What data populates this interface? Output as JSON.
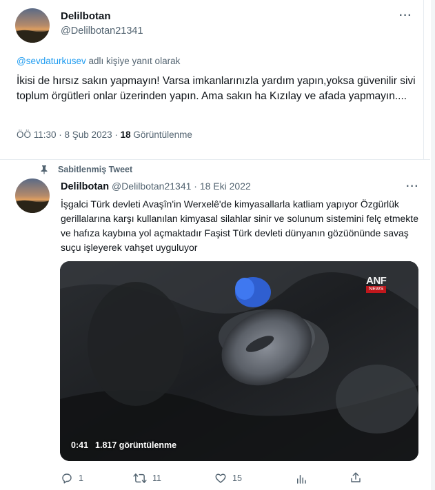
{
  "reply_tweet": {
    "display_name": "Delilbotan",
    "handle": "@Delilbotan21341",
    "reply_to_handle": "@sevdaturkusev",
    "reply_to_suffix": "adlı kişiye yanıt olarak",
    "text": "İkisi de hırsız sakın yapmayın! Varsa imkanlarınızla yardım yapın,yoksa güvenilir sivi toplum örgütleri onlar üzerinden yapın. Ama sakın ha Kızılay ve afada yapmayın....",
    "timestamp": "ÖÖ 11:30 · 8 Şub 2023 · ",
    "views_count": "18",
    "views_label": " Görüntülenme",
    "more_icon": "more-horizontal-icon"
  },
  "pinned_tweet": {
    "pinned_label": "Sabitlenmiş Tweet",
    "display_name": "Delilbotan",
    "handle": "@Delilbotan21341",
    "date": "· 18 Eki 2022",
    "text": "İşgalci Türk devleti Avaşîn'in Werxelê'de kimyasallarla katliam yapıyor Özgürlük gerillalarına karşı kullanılan kimyasal silahlar sinir ve solunum sistemini felç etmekte ve hafıza kaybına yol açmaktadır Faşist Türk devleti dünyanın gözüönünde savaş suçu işleyerek vahşet uyguluyor",
    "video": {
      "watermark": "ANF",
      "watermark_sub": "NEWS",
      "duration": "0:41",
      "views": "1.817 görüntülenme"
    },
    "actions": {
      "reply_count": "1",
      "retweet_count": "11",
      "like_count": "15"
    },
    "colors": {
      "link": "#1d9bf0",
      "secondary_text": "#536471",
      "video_bg": "#1a1c1f"
    }
  }
}
